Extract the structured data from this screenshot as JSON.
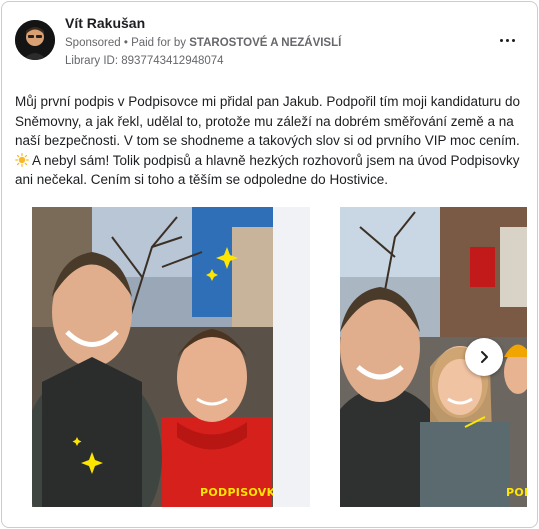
{
  "post": {
    "author": "Vít Rakušan",
    "sponsored_label": "Sponsored",
    "paid_for_prefix": "Paid for by",
    "payer": "STAROSTOVÉ A NEZÁVISLÍ",
    "library_id": "Library ID: 8937743412948074",
    "text_part1": "Můj první podpis v Podpisovce mi přidal pan Jakub. Podpořil tím moji kandidaturu do Sněmovny, a jak řekl, udělal to, protože mu záleží na dobrém směřování země a na naší bezpečnosti. V tom se shodneme a takových slov si od prvního VIP moc cením. ",
    "text_part2": " A nebyl sám! Tolik podpisů a hlavně hezkých rozhovorů jsem na úvod Podpisovky ani nečekal. Cením si toho a těším se odpoledne do Hostivice."
  },
  "carousel": {
    "slides": [
      {
        "label": "PODPISOVKA"
      },
      {
        "label": "PODPISOVKA"
      }
    ],
    "next_icon": "chevron-right-icon"
  },
  "colors": {
    "accent_yellow": "#ffe600",
    "text_secondary": "#65676b"
  }
}
